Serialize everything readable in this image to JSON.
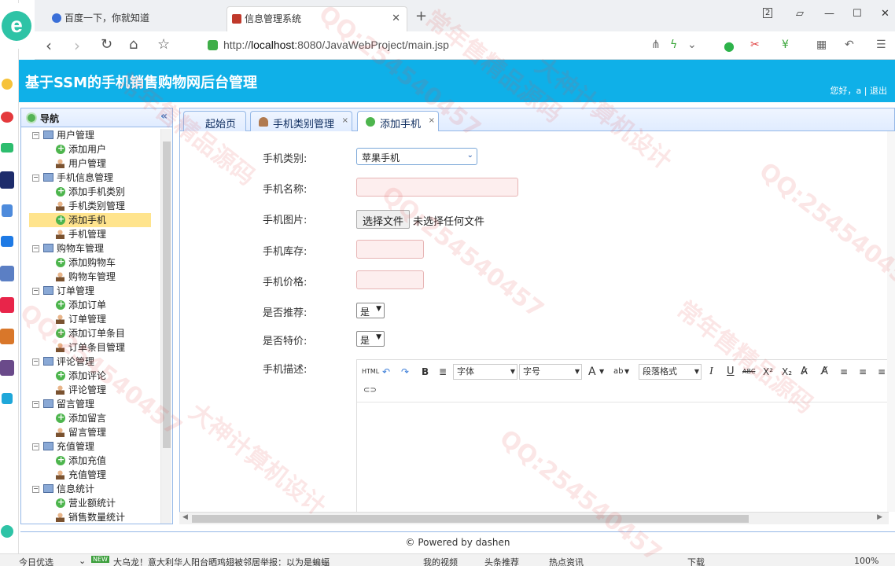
{
  "browser": {
    "tabs": [
      {
        "label": "百度一下，你就知道",
        "icon": "paw-icon"
      },
      {
        "label": "信息管理系统",
        "icon": "page-icon",
        "active": true
      }
    ],
    "tab_count": "2",
    "url_prefix": "http://",
    "url_host": "localhost",
    "url_rest": ":8080/JavaWebProject/main.jsp"
  },
  "app": {
    "title": "基于SSM的手机销售购物网后台管理",
    "user_greeting": "您好，a",
    "separator": "|",
    "logout_label": "退出"
  },
  "nav": {
    "title": "导航",
    "collapse": "«",
    "groups": [
      {
        "label": "用户管理",
        "items": [
          {
            "label": "添加用户",
            "icon": "add"
          },
          {
            "label": "用户管理",
            "icon": "user"
          }
        ]
      },
      {
        "label": "手机信息管理",
        "items": [
          {
            "label": "添加手机类别",
            "icon": "add"
          },
          {
            "label": "手机类别管理",
            "icon": "user"
          },
          {
            "label": "添加手机",
            "icon": "add",
            "selected": true
          },
          {
            "label": "手机管理",
            "icon": "user"
          }
        ]
      },
      {
        "label": "购物车管理",
        "items": [
          {
            "label": "添加购物车",
            "icon": "add"
          },
          {
            "label": "购物车管理",
            "icon": "user"
          }
        ]
      },
      {
        "label": "订单管理",
        "items": [
          {
            "label": "添加订单",
            "icon": "add"
          },
          {
            "label": "订单管理",
            "icon": "user"
          },
          {
            "label": "添加订单条目",
            "icon": "add"
          },
          {
            "label": "订单条目管理",
            "icon": "user"
          }
        ]
      },
      {
        "label": "评论管理",
        "items": [
          {
            "label": "添加评论",
            "icon": "add"
          },
          {
            "label": "评论管理",
            "icon": "user"
          }
        ]
      },
      {
        "label": "留言管理",
        "items": [
          {
            "label": "添加留言",
            "icon": "add"
          },
          {
            "label": "留言管理",
            "icon": "user"
          }
        ]
      },
      {
        "label": "充值管理",
        "items": [
          {
            "label": "添加充值",
            "icon": "add"
          },
          {
            "label": "充值管理",
            "icon": "user"
          }
        ]
      },
      {
        "label": "信息统计",
        "items": [
          {
            "label": "营业额统计",
            "icon": "add"
          },
          {
            "label": "销售数量统计",
            "icon": "user"
          }
        ]
      }
    ]
  },
  "content_tabs": [
    {
      "label": "起始页"
    },
    {
      "label": "手机类别管理",
      "closable": "×"
    },
    {
      "label": "添加手机",
      "closable": "×",
      "active": true
    }
  ],
  "form": {
    "category_label": "手机类别:",
    "category_value": "苹果手机",
    "name_label": "手机名称:",
    "name_value": "",
    "image_label": "手机图片:",
    "file_button": "选择文件",
    "file_status": "未选择任何文件",
    "stock_label": "手机库存:",
    "stock_value": "",
    "price_label": "手机价格:",
    "price_value": "",
    "recommend_label": "是否推荐:",
    "recommend_value": "是",
    "special_label": "是否特价:",
    "special_value": "是",
    "desc_label": "手机描述:"
  },
  "editor": {
    "html": "HTML",
    "font_family": "字体",
    "font_size": "字号",
    "paragraph": "段落格式",
    "bold": "B",
    "italic": "I",
    "underline": "U",
    "strike": "ABC",
    "superscript": "X²",
    "subscript": "X₂",
    "font_color": "A",
    "highlight": "ab"
  },
  "footer": {
    "text": "© Powered by dashen"
  },
  "statusbar": {
    "left": "今日优选",
    "badge": "NEW",
    "news": "大乌龙！意大利华人阳台晒鸡翅被邻居举报：以为是蝙蝠",
    "video": "我的视频",
    "headline": "头条推荐",
    "hot": "热点资讯",
    "download": "下载",
    "zoom": "100%"
  },
  "watermarks": [
    "QQ:254540457",
    "大神计算机设计",
    "常年售精品源码"
  ],
  "colors": {
    "header_bg": "#0fb0e8",
    "panel_border": "#95b8e7",
    "selected_bg": "#ffe48d"
  }
}
